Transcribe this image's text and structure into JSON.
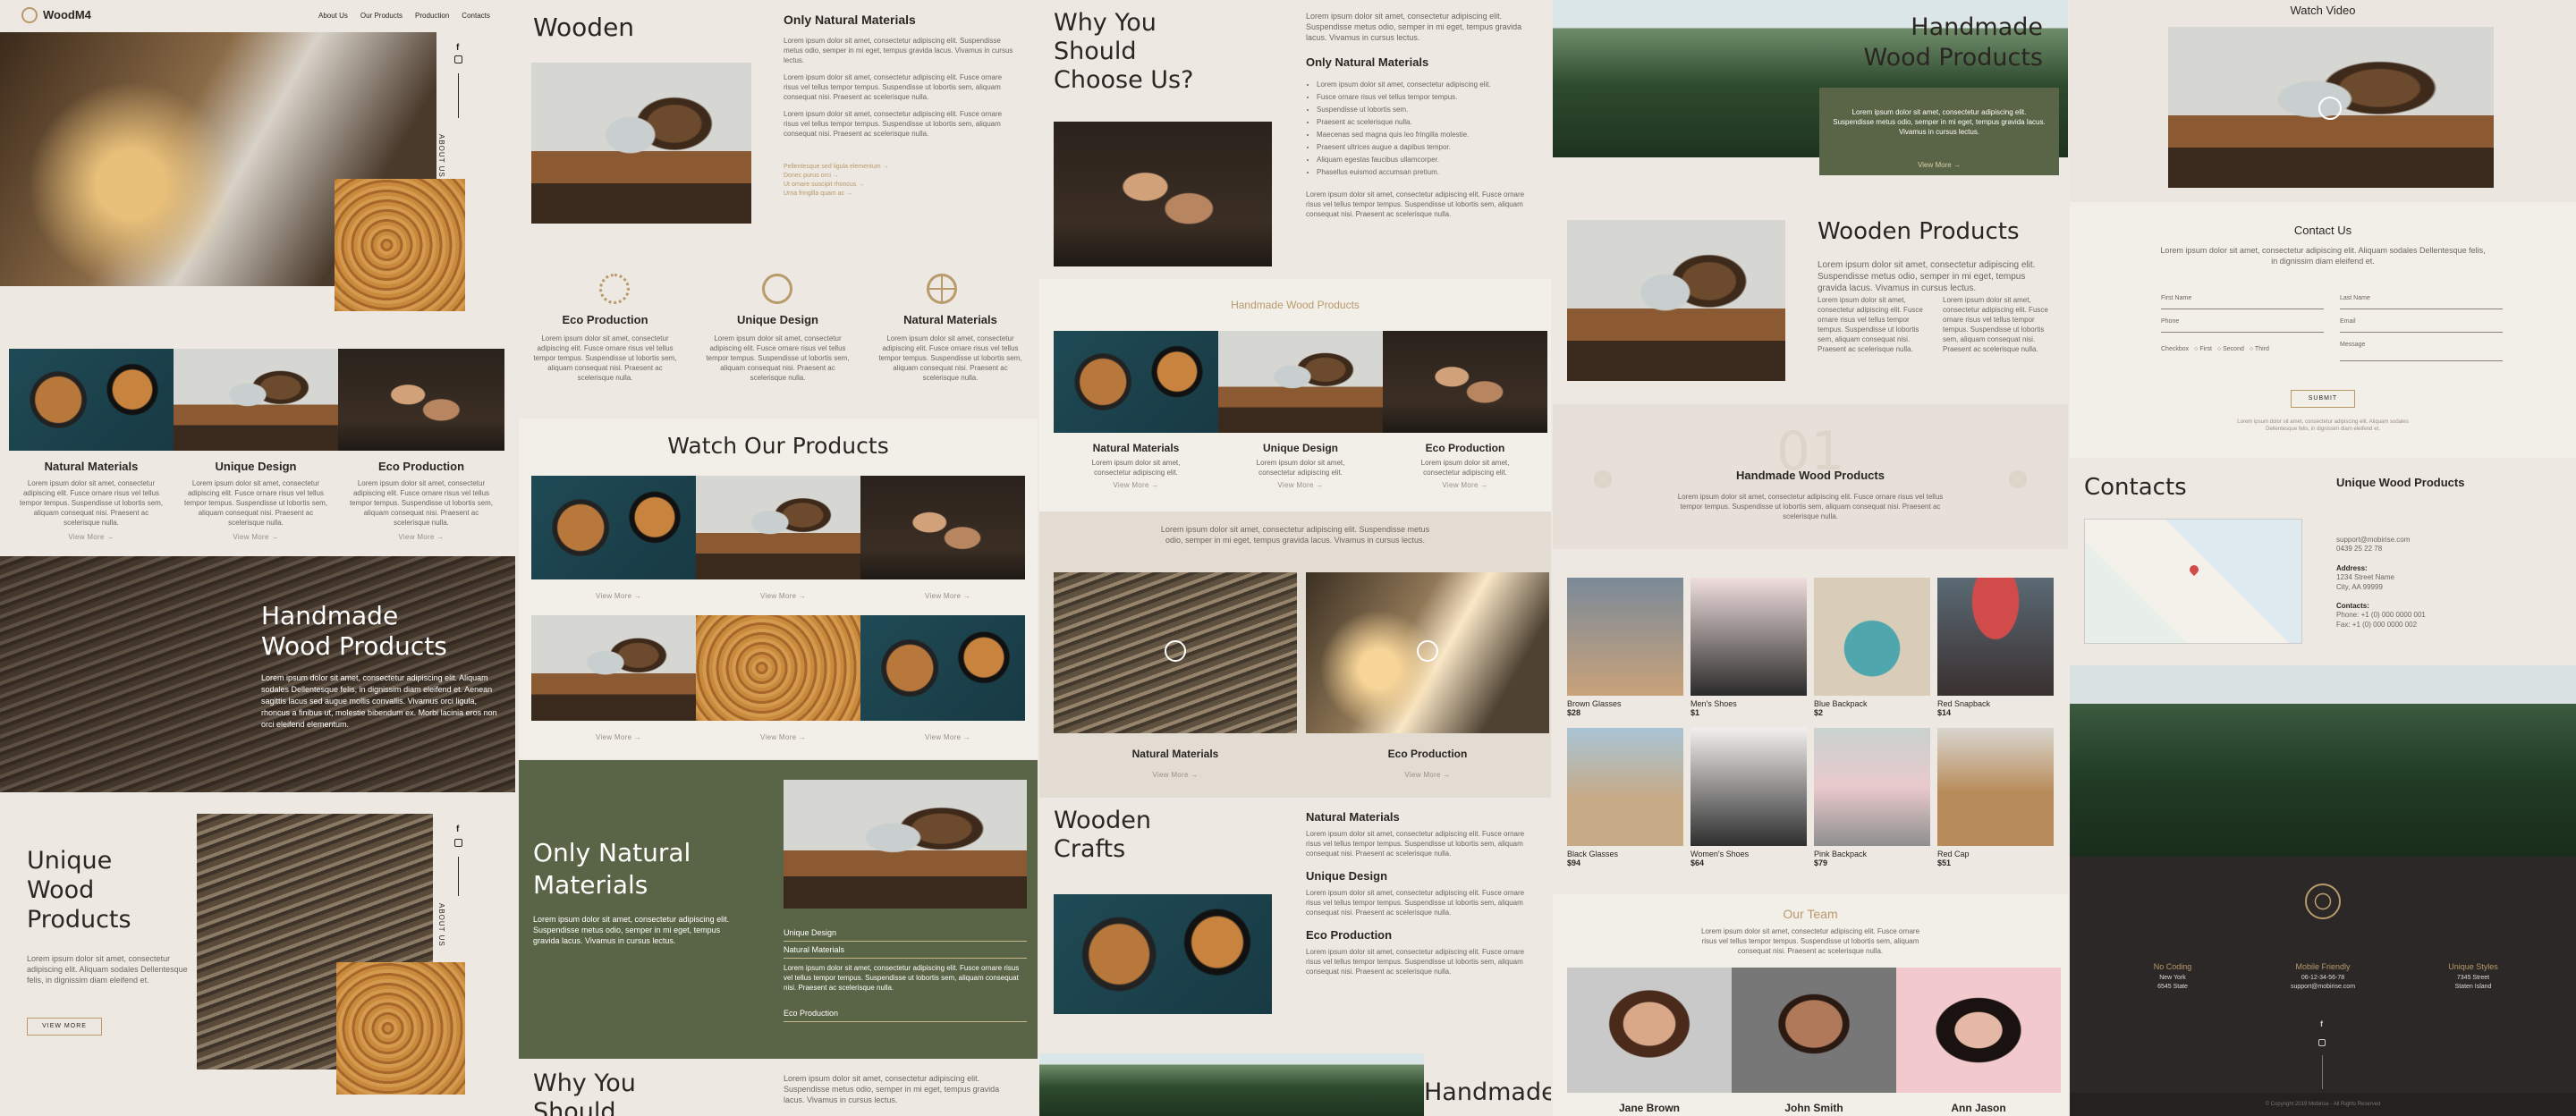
{
  "brand": {
    "name": "WoodM4"
  },
  "nav": [
    "About Us",
    "Our Products",
    "Production",
    "Contacts"
  ],
  "lorem": {
    "short": "Lorem ipsum dolor sit amet, consectetur adipiscing elit.",
    "mid": "Lorem ipsum dolor sit amet, consectetur adipiscing elit. Suspendisse metus odio, semper in mi eget, tempus gravida lacus. Vivamus in cursus lectus.",
    "para": "Lorem ipsum dolor sit amet, consectetur adipiscing elit. Fusce ornare risus vel tellus tempor tempus. Suspendisse ut lobortis sem, aliquam consequat nisi. Praesent ac scelerisque nulla.",
    "handmade": "Lorem ipsum dolor sit amet, consectetur adipiscing elit. Aliquam sodales Dellentesque felis, in dignissim diam eleifend et. Aenean sagittis lacus sed augue mollis convallis. Vivamus orci ligula, rhoncus a finibus ut, molestie bibendum ex. Morbi lacinia eros non orci eleifend elementum.",
    "short2": "Lorem ipsum dolor sit amet, consectetur adipiscing elit. Aliquam sodales Dellentesque felis, in dignissim diam eleifend et."
  },
  "common": {
    "view_more": "View More →",
    "view_more_caps": "VIEW MORE",
    "submit": "SUBMIT",
    "about_us": "ABOUT US"
  },
  "col1": {
    "features": [
      "Natural Materials",
      "Unique Design",
      "Eco Production"
    ],
    "handmade_title": "Handmade\nWood Products",
    "unique_title": "Unique\nWood\nProducts"
  },
  "col2": {
    "wooden": "Wooden",
    "only_natural": "Only Natural Materials",
    "list_links": [
      "Pellentesque sed ligula elementum →",
      "Donec purus orci →",
      "Ut ornare suscipit rhoncus →",
      "Urna fringilla quam ac →"
    ],
    "features": [
      "Eco Production",
      "Unique Design",
      "Natural Materials"
    ],
    "watch_title": "Watch Our Products",
    "only_natural_big": "Only Natural\nMaterials",
    "accordion": [
      "Unique Design",
      "Natural Materials",
      "Eco Production"
    ],
    "why": "Why You\nShould"
  },
  "col3": {
    "why": "Why You\nShould\nChoose Us?",
    "only_natural": "Only Natural Materials",
    "bullets": [
      "Lorem ipsum dolor sit amet, consectetur adipiscing elit.",
      "Fusce ornare risus vel tellus tempor tempus.",
      "Suspendisse ut lobortis sem.",
      "Praesent ac scelerisque nulla.",
      "Maecenas sed magna quis leo fringilla molestie.",
      "Praesent ultrices augue a dapibus tempor.",
      "Aliquam egestas faucibus ullamcorper.",
      "Phasellus euismod accumsan pretium."
    ],
    "handmade_small": "Handmade Wood Products",
    "features": [
      "Natural Materials",
      "Unique Design",
      "Eco Production"
    ],
    "video_features": [
      "Natural Materials",
      "Eco Production"
    ],
    "crafts": "Wooden\nCrafts",
    "crafts_items": [
      "Natural Materials",
      "Unique Design",
      "Eco Production"
    ],
    "handmade_bottom": "Handmade"
  },
  "col4": {
    "hero_title": "Handmade\nWood Products",
    "wooden_products": "Wooden Products",
    "number": "01",
    "handmade_center": "Handmade Wood Products",
    "products": [
      {
        "name": "Brown Glasses",
        "price": "$28"
      },
      {
        "name": "Men's Shoes",
        "price": "$1"
      },
      {
        "name": "Blue Backpack",
        "price": "$2"
      },
      {
        "name": "Red Snapback",
        "price": "$14"
      },
      {
        "name": "Black Glasses",
        "price": "$94"
      },
      {
        "name": "Women's Shoes",
        "price": "$64"
      },
      {
        "name": "Pink Backpack",
        "price": "$79"
      },
      {
        "name": "Red Cap",
        "price": "$51"
      }
    ],
    "team_title": "Our Team",
    "team": [
      "Jane Brown",
      "John Smith",
      "Ann Jason"
    ]
  },
  "col5": {
    "watch_video": "Watch Video",
    "contact_us": "Contact Us",
    "form": {
      "first": "First Name",
      "last": "Last Name",
      "phone": "Phone",
      "email": "Email",
      "message": "Message",
      "checkbox_label": "Checkbox",
      "opts": [
        "First",
        "Second",
        "Third"
      ]
    },
    "contacts_title": "Contacts",
    "company": "Unique Wood Products",
    "email": "support@mobirise.com",
    "phone": "0439 25 22 78",
    "address_label": "Address:",
    "address": "1234 Street Name\nCity, AA 99999",
    "contacts_label": "Contacts:",
    "contacts": "Phone: +1 (0) 000 0000 001\nFax: +1 (0) 000 0000 002",
    "footer_cols": [
      {
        "title": "No Coding",
        "lines": "New York\n6545 State"
      },
      {
        "title": "Mobile Friendly",
        "lines": "06-12-34-56-78\nsupport@mobirise.com"
      },
      {
        "title": "Unique Styles",
        "lines": "7345 Street\nStaten Island"
      }
    ],
    "copyright": "© Copyright 2019 Mobirise - All Rights Reserved"
  },
  "colors": {
    "bg": "#ede8e1",
    "olive": "#5a6446",
    "dark": "#2b2827",
    "gold": "#b89a6b"
  }
}
